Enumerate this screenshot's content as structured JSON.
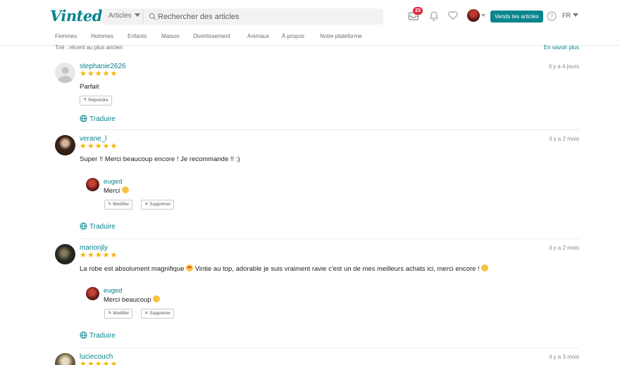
{
  "header": {
    "logo": "Vinted",
    "search_category": "Articles",
    "search_placeholder": "Rechercher des articles",
    "inbox_badge": "23",
    "sell_button": "Vends tes articles",
    "language": "FR"
  },
  "nav": {
    "items": [
      "Femmes",
      "Hommes",
      "Enfants",
      "Maison",
      "Divertissement",
      "Animaux",
      "À propos",
      "Notre plateforme"
    ]
  },
  "page": {
    "sort_label": "Trié : récent au plus ancien",
    "learn_more": "En savoir plus"
  },
  "reviews": [
    {
      "user": "stephanie2626",
      "stars": "★★★★★",
      "time": "il y a 4 jours",
      "text": "Parfait",
      "reply_button": "Répondre",
      "translate": "Traduire"
    },
    {
      "user": "verane_l",
      "stars": "★★★★★",
      "time": "il y a 2 mois",
      "text": "Super !! Merci beaucoup encore ! Je recommande !! :)",
      "reply": {
        "user": "euged",
        "text": "Merci",
        "edit": "Modifier",
        "delete": "Supprimer"
      },
      "translate": "Traduire"
    },
    {
      "user": "marionjly",
      "stars": "★★★★★",
      "time": "il y a 2 mois",
      "text": "La robe est absolument magnifique",
      "text_rest": "Vintie au top, adorable je suis vraiment ravie c'est un de mes meilleurs achats ici, merci encore !",
      "reply": {
        "user": "euged",
        "text": "Merci beaucoup",
        "edit": "Modifier",
        "delete": "Supprimer"
      },
      "translate": "Traduire"
    },
    {
      "user": "luciecouch",
      "stars": "★★★★★",
      "time": "il y a 3 mois"
    }
  ],
  "colors": {
    "brand": "#09858f",
    "star": "#f5b400",
    "badge": "#e0283b"
  }
}
